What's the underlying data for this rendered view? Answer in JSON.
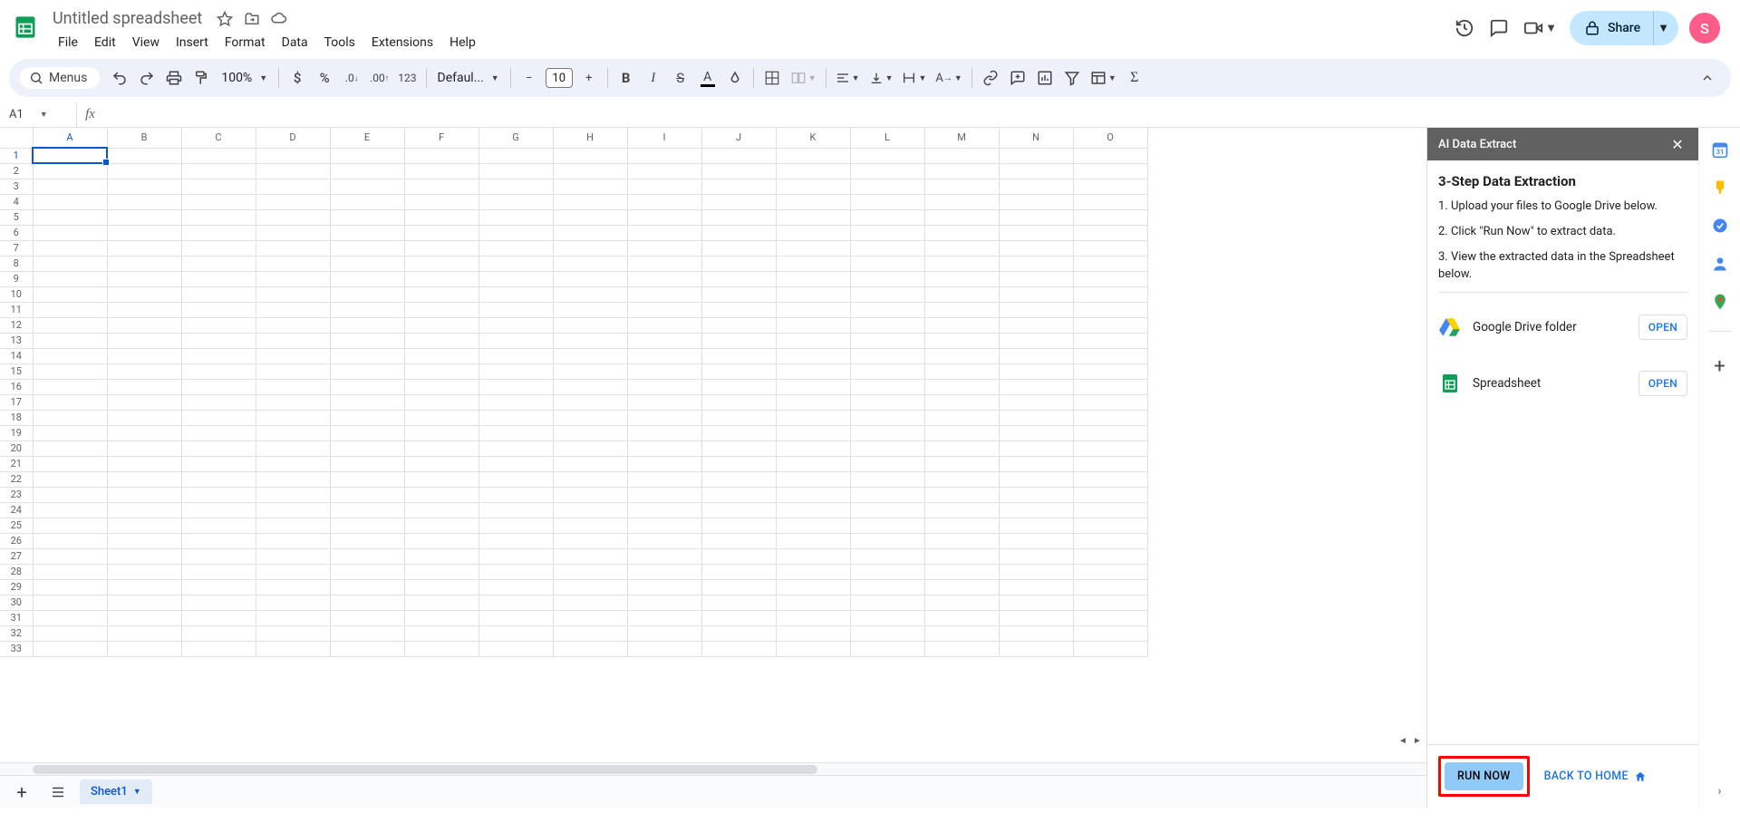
{
  "header": {
    "doc_title": "Untitled spreadsheet",
    "menus": [
      "File",
      "Edit",
      "View",
      "Insert",
      "Format",
      "Data",
      "Tools",
      "Extensions",
      "Help"
    ],
    "share_label": "Share",
    "avatar_letter": "S"
  },
  "toolbar": {
    "menus_label": "Menus",
    "zoom": "100%",
    "font": "Defaul...",
    "font_size": "10",
    "number_format_123": "123"
  },
  "name_box": {
    "cell": "A1"
  },
  "sheet": {
    "columns": [
      "A",
      "B",
      "C",
      "D",
      "E",
      "F",
      "G",
      "H",
      "I",
      "J",
      "K",
      "L",
      "M",
      "N",
      "O"
    ],
    "row_count": 33,
    "selected_cell": "A1",
    "tab_label": "Sheet1"
  },
  "side_panel": {
    "header": "AI Data Extract",
    "title": "3-Step Data Extraction",
    "steps": [
      "1. Upload your files to Google Drive below.",
      "2. Click \"Run Now\" to extract data.",
      "3. View the extracted data in the Spreadsheet below."
    ],
    "card_drive": "Google Drive folder",
    "card_sheet": "Spreadsheet",
    "open_label": "OPEN",
    "run_label": "RUN NOW",
    "back_label": "BACK TO HOME"
  }
}
